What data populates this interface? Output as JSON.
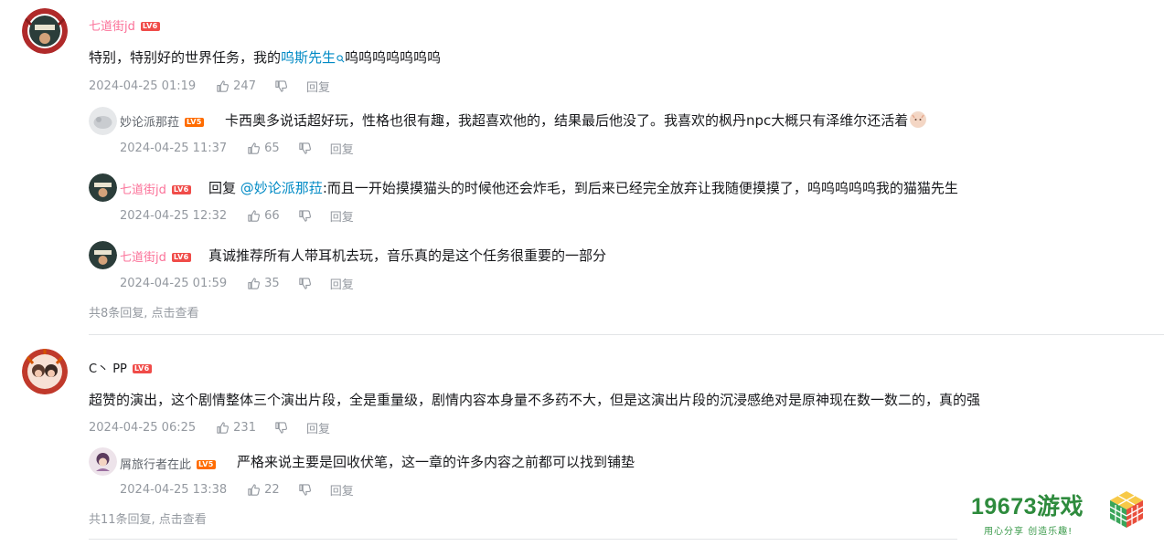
{
  "comments": [
    {
      "user": "七道街jd",
      "level": "LV6",
      "content_prefix": "特别，特别好的世界任务，我的",
      "content_link": "呜斯先生",
      "content_suffix": "呜呜呜呜呜呜呜",
      "time": "2024-04-25 01:19",
      "likes": "247",
      "reply_label": "回复",
      "replies": [
        {
          "user": "妙论派那菈",
          "level": "LV5",
          "content": "卡西奥多说话超好玩，性格也很有趣，我超喜欢他的，结果最后他没了。我喜欢的枫丹npc大概只有泽维尔还活着",
          "time": "2024-04-25 11:37",
          "likes": "65",
          "reply_label": "回复"
        },
        {
          "user": "七道街jd",
          "level": "LV6",
          "reply_prefix": "回复",
          "mention": "@妙论派那菈",
          "content": ":而且一开始摸摸猫头的时候他还会炸毛，到后来已经完全放弃让我随便摸摸了，呜呜呜呜呜我的猫猫先生",
          "time": "2024-04-25 12:32",
          "likes": "66",
          "reply_label": "回复"
        },
        {
          "user": "七道街jd",
          "level": "LV6",
          "content": "真诚推荐所有人带耳机去玩，音乐真的是这个任务很重要的一部分",
          "time": "2024-04-25 01:59",
          "likes": "35",
          "reply_label": "回复"
        }
      ],
      "more_replies": "共8条回复, 点击查看"
    },
    {
      "user": "C丶 PP",
      "level": "LV6",
      "content": "超赞的演出，这个剧情整体三个演出片段，全是重量级，剧情内容本身量不多药不大，但是这演出片段的沉浸感绝对是原神现在数一数二的，真的强",
      "time": "2024-04-25 06:25",
      "likes": "231",
      "reply_label": "回复",
      "replies": [
        {
          "user": "屑旅行者在此",
          "level": "LV5",
          "content": "严格来说主要是回收伏笔，这一章的许多内容之前都可以找到铺垫",
          "time": "2024-04-25 13:38",
          "likes": "22",
          "reply_label": "回复"
        }
      ],
      "more_replies": "共11条回复, 点击查看"
    }
  ],
  "watermark": {
    "title": "19673游戏",
    "slogan": "用心分享 创造乐趣!"
  },
  "colors": {
    "username_pink": "#fb7299",
    "link_blue": "#008ac5",
    "meta_gray": "#9499a0",
    "logo_green": "#2e8b3d"
  }
}
